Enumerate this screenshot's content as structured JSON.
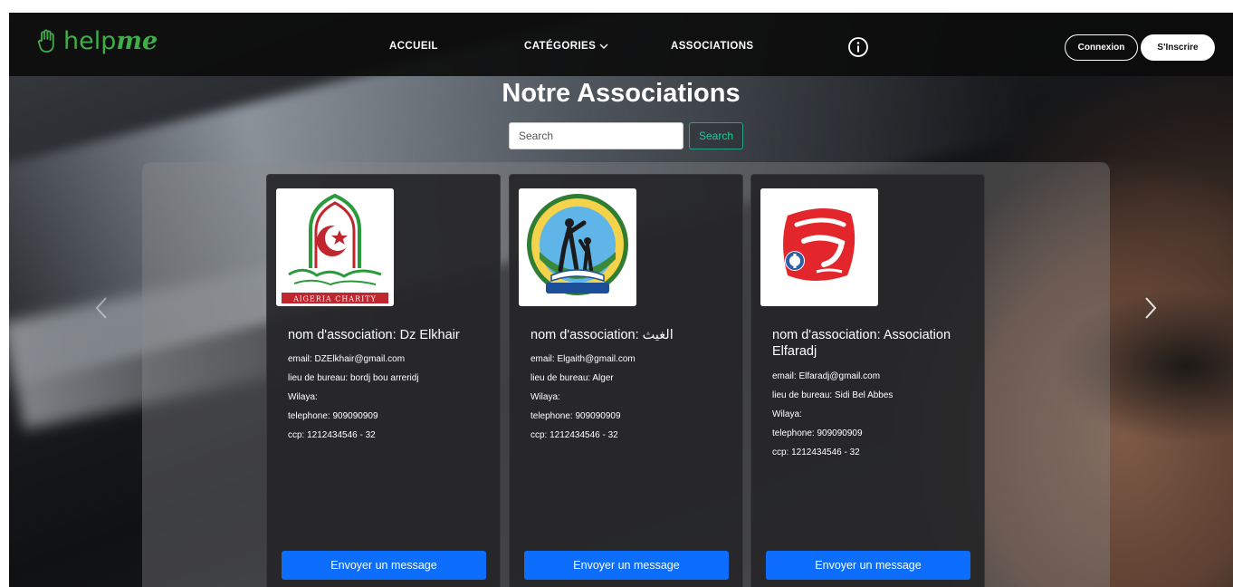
{
  "brand": {
    "name_regular": "help",
    "name_bold": "me"
  },
  "nav": {
    "accueil": "ACCUEIL",
    "categories": "CATÉGORIES",
    "associations": "ASSOCIATIONS",
    "info_icon": "info-icon"
  },
  "auth": {
    "login": "Connexion",
    "signup": "S'Inscrire"
  },
  "page": {
    "title": "Notre Associations"
  },
  "search": {
    "placeholder": "Search",
    "button": "Search"
  },
  "cards": [
    {
      "name": "nom d'association: Dz Elkhair",
      "email": "email: DZElkhair@gmail.com",
      "office": "lieu de bureau: bordj bou arreridj",
      "wilaya": "Wilaya:",
      "telephone": "telephone: 909090909",
      "ccp": "ccp: 1212434546 - 32",
      "logo_text": "AlGERIA CHARITY",
      "button": "Envoyer un message"
    },
    {
      "name": "nom d'association: الغيث",
      "email": "email: Elgaith@gmail.com",
      "office": "lieu de bureau: Alger",
      "wilaya": "Wilaya:",
      "telephone": "telephone: 909090909",
      "ccp": "ccp: 1212434546 - 32",
      "button": "Envoyer un message"
    },
    {
      "name": "nom d'association: Association Elfaradj",
      "email": "email: Elfaradj@gmail.com",
      "office": "lieu de bureau: Sidi Bel Abbes",
      "wilaya": "Wilaya:",
      "telephone": "telephone: 909090909",
      "ccp": "ccp: 1212434546 - 32",
      "button": "Envoyer un message"
    }
  ],
  "colors": {
    "brand_green": "#3fae49",
    "primary_blue": "#0d6efd",
    "search_teal": "#20c997"
  }
}
